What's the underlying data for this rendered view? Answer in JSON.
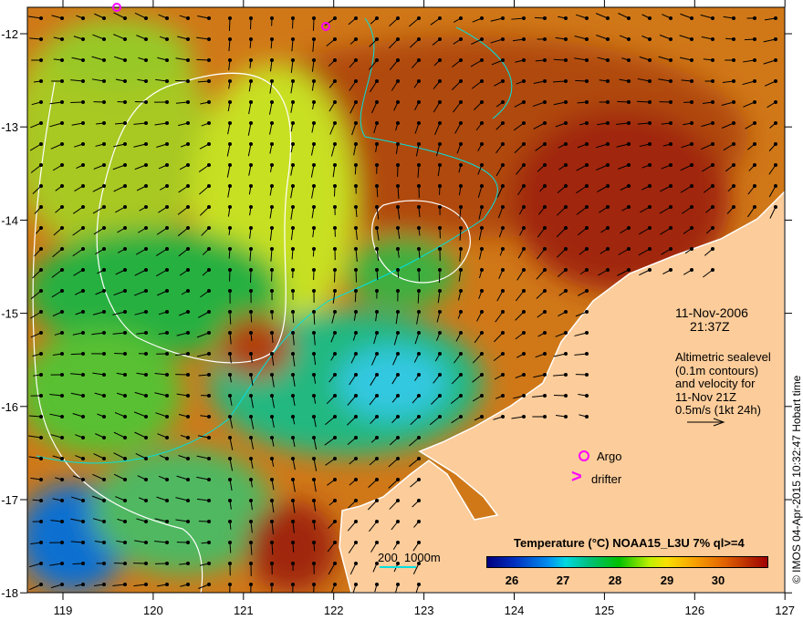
{
  "title": {
    "date": "11-Nov-2006",
    "time": "21:37Z"
  },
  "annotation": [
    "Altimetric sealevel",
    "(0.1m contours)",
    "and velocity for",
    "11-Nov 21Z",
    "0.5m/s (1kt 24h)"
  ],
  "legend": {
    "argo": "Argo",
    "drifter": "drifter",
    "drifter_symbol": ">",
    "bathymetry": "200  1000m"
  },
  "colorbar": {
    "title": "Temperature (°C) NOAA15_L3U 7% ql>=4",
    "ticks": [
      "26",
      "27",
      "28",
      "29",
      "30"
    ],
    "range": [
      25.5,
      30.8
    ]
  },
  "x_ticks": [
    "119",
    "120",
    "121",
    "122",
    "123",
    "124",
    "125",
    "126",
    "127"
  ],
  "y_ticks": [
    "-12",
    "-13",
    "-14",
    "-15",
    "-16",
    "-17",
    "-18"
  ],
  "credit": "© IMOS 04-Apr-2015 10:32:47 Hobart time",
  "colors": {
    "land": "#fccc9a",
    "marker": "#ff00ff",
    "contour": "#ffffff",
    "isobath": "#00e0e0"
  }
}
